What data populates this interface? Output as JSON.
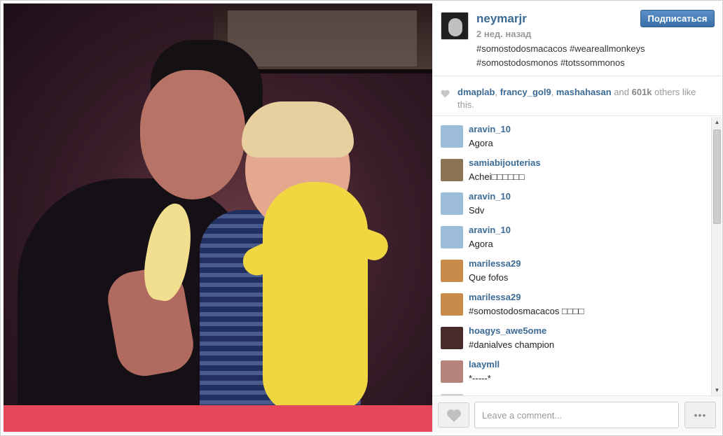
{
  "post": {
    "username": "neymarjr",
    "time": "2 нед. назад",
    "follow_label": "Подписаться",
    "caption_line1": "#somostodosmacacos #weareallmonkeys",
    "caption_line2": "#somostodosmonos #totssommonos"
  },
  "likes": {
    "user1": "dmaplab",
    "sep1": ", ",
    "user2": "francy_gol9",
    "sep2": ", ",
    "user3": "mashahasan",
    "and": " and ",
    "count": "601k",
    "rest": " others like this."
  },
  "comments": [
    {
      "user": "aravin_10",
      "text": "Agora",
      "avatar_color": "#9cbcd8"
    },
    {
      "user": "samiabijouterias",
      "text": "Achei□□□□□□",
      "avatar_color": "#8b7356"
    },
    {
      "user": "aravin_10",
      "text": "Sdv",
      "avatar_color": "#9cbcd8"
    },
    {
      "user": "aravin_10",
      "text": "Agora",
      "avatar_color": "#9cbcd8"
    },
    {
      "user": "marilessa29",
      "text": "Que fofos",
      "avatar_color": "#c78a4a"
    },
    {
      "user": "marilessa29",
      "text": "#somostodosmacacos □□□□",
      "avatar_color": "#c78a4a"
    },
    {
      "user": "hoagys_awe5ome",
      "text": "#danialves champion",
      "avatar_color": "#4a2b2b"
    },
    {
      "user": "laaymll",
      "text": "*-----*",
      "avatar_color": "#b5837b"
    },
    {
      "user": "",
      "text": "",
      "avatar_color": "#cccccc"
    }
  ],
  "footer": {
    "comment_placeholder": "Leave a comment...",
    "more_label": "•••"
  },
  "colors": {
    "link": "#3b6a94",
    "follow_button": "#3a6fa8"
  }
}
